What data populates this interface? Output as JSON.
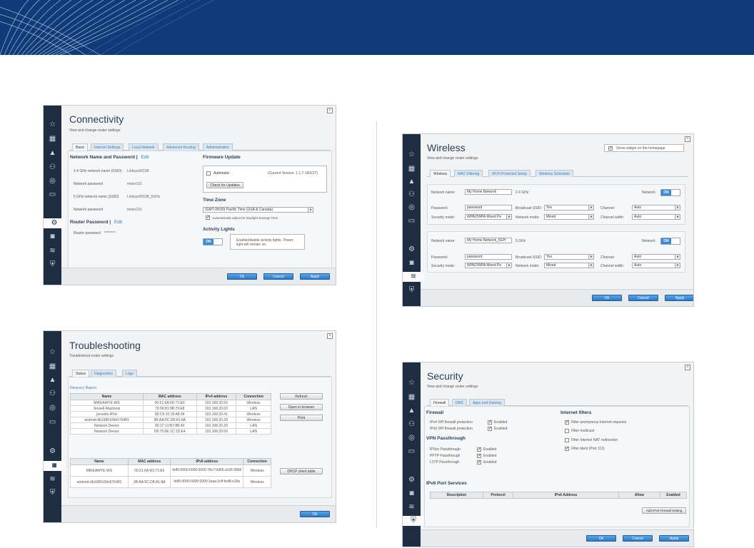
{
  "connectivity": {
    "title": "Connectivity",
    "subtitle": "View and change router settings",
    "tabs": [
      "Basic",
      "Internet Settings",
      "Local Network",
      "Advanced Routing",
      "Administration"
    ],
    "network_header": "Network Name and Password",
    "edit": "Edit",
    "rows": [
      {
        "label": "2.4 GHz network name (SSID)",
        "value": "Linksys00198"
      },
      {
        "label": "Network password",
        "value": "meier131"
      },
      {
        "label": "5 GHz network name (SSID)",
        "value": "Linksys00198_5GHz"
      },
      {
        "label": "Network password",
        "value": "meier131"
      }
    ],
    "router_password_header": "Router Password",
    "router_password_label": "Router password",
    "router_password_value": "********",
    "firmware_header": "Firmware Update",
    "automatic_label": "Automatic",
    "current_version": "(Current Version: 1.1.7.160227)",
    "check_updates": "Check for Updates",
    "timezone_header": "Time Zone",
    "timezone_value": "(GMT-08:00) Pacific Time (USA & Canada)",
    "dst_label": "Automatically adjust for Daylight Savings Time",
    "activity_header": "Activity Lights",
    "toggle_on": "ON",
    "activity_text": "Enable/disable activity lights. Power light will remain on.",
    "ok": "Ok",
    "cancel": "Cancel",
    "apply": "Apply"
  },
  "wireless": {
    "title": "Wireless",
    "subtitle": "View and change router settings",
    "show_widget": "Show widget on the homepage",
    "tabs": [
      "Wireless",
      "MAC Filtering",
      "Wi-Fi Protected Setup",
      "Wireless Scheduler"
    ],
    "band1": {
      "network_name_label": "Network name:",
      "network_name": "My Home Network",
      "band": "2.4 GHz",
      "network_label": "Network:",
      "toggle": "ON",
      "password_label": "Password:",
      "password": "password",
      "broadcast_label": "Broadcast SSID:",
      "broadcast": "Yes",
      "channel_label": "Channel:",
      "channel": "Auto",
      "security_label": "Security mode:",
      "security": "WPA2/WPA Mixed Pe",
      "mode_label": "Network mode:",
      "mode": "Mixed",
      "width_label": "Channel width:",
      "width": "Auto"
    },
    "band2": {
      "network_name_label": "Network name:",
      "network_name": "My Home Network_5GH",
      "band": "5 GHz",
      "network_label": "Network:",
      "toggle": "ON",
      "password_label": "Password:",
      "password": "password",
      "broadcast_label": "Broadcast SSID:",
      "broadcast": "Yes",
      "channel_label": "Channel:",
      "channel": "Auto",
      "security_label": "Security mode:",
      "security": "WPA2/WPA Mixed Pe",
      "mode_label": "Network mode:",
      "mode": "Mixed",
      "width_label": "Channel width:",
      "width": "Auto"
    },
    "ok": "Ok",
    "cancel": "Cancel",
    "apply": "Apply"
  },
  "troubleshooting": {
    "title": "Troubleshooting",
    "subtitle": "Troubleshoot router settings",
    "tabs": [
      "Status",
      "Diagnostics",
      "Logs"
    ],
    "devices_link": "Devices",
    "report_link": "Report",
    "ipv4_headers": [
      "Name",
      "MAC address",
      "IPv4 address",
      "Connection"
    ],
    "ipv4_rows": [
      [
        "MIKEAWYE-WS",
        "00:21:6A:6D:71:E6",
        "192.168.20.50",
        "Wireless"
      ],
      [
        "Jensell-Macbook",
        "70:56:81:9B:79:E8",
        "192.168.20.63",
        "LAN"
      ],
      [
        "jensells-iPod",
        "00:C6:10:19:A8:34",
        "192.168.20.41",
        "Wireless"
      ],
      [
        "android-db1686169e576481",
        "3B:AA:5C:D8:A1:8A",
        "192.168.20.39",
        "Wireless"
      ],
      [
        "Network Device",
        "00:27:13:B7:8B:40",
        "192.168.20.29",
        "LAN"
      ],
      [
        "Network Device",
        "D8:75:0E:1C:1D:E4",
        "192.168.20.59",
        "LAN"
      ]
    ],
    "ipv6_headers": [
      "Name",
      "MAC address",
      "IPv6 address",
      "Connection"
    ],
    "ipv6_rows": [
      [
        "MIKEAWYE-WS",
        "00:21:6A:6D:71:E6",
        "fe80:0000:0000:0000:78c7:9d95:cb39:3858",
        "Wireless"
      ],
      [
        "android-db1686169e576481",
        "3B:AA:5C:D8:A1:8A",
        "fe80:0000:0000:0000:3aaa:3cff:fed8:a18a",
        "Wireless"
      ]
    ],
    "refresh": "Refresh",
    "open_browser": "Open in browser",
    "print": "Print",
    "dhcp": "DHCP client table",
    "ok": "Ok"
  },
  "security": {
    "title": "Security",
    "subtitle": "View and change router settings",
    "tabs": [
      "Firewall",
      "DMZ",
      "Apps and Gaming"
    ],
    "firewall_header": "Firewall",
    "firewall_rows": [
      {
        "label": "IPv4 SPI firewall protection",
        "value": "Enabled"
      },
      {
        "label": "IPv6 SPI firewall protection",
        "value": "Enabled"
      }
    ],
    "vpn_header": "VPN Passthrough",
    "vpn_rows": [
      {
        "label": "IPSec Passthrough",
        "value": "Enabled"
      },
      {
        "label": "PPTP Passthrough",
        "value": "Enabled"
      },
      {
        "label": "L2TP Passthrough",
        "value": "Enabled"
      }
    ],
    "filters_header": "Internet filters",
    "filters": [
      {
        "label": "Filter anonymous Internet requests",
        "checked": true
      },
      {
        "label": "Filter multicast",
        "checked": false
      },
      {
        "label": "Filter Internet NAT redirection",
        "checked": false
      },
      {
        "label": "Filter ident (Port 113)",
        "checked": true
      }
    ],
    "ipv6_header": "IPv6 Port Services",
    "ipv6_cols": [
      "Description",
      "Protocol",
      "IPv6 Address",
      "Allow",
      "Enabled"
    ],
    "add_rule": "Add IPv6 Firewall Setting",
    "ok": "Ok",
    "cancel": "Cancel",
    "apply": "Apply"
  },
  "colors": {
    "banner": "#0f3c78",
    "sidebar": "#1e2d42",
    "accent": "#3a8ad6"
  },
  "sidebar_icons": [
    "widgets-icon",
    "devices-icon",
    "alert-icon",
    "parental-icon",
    "media-icon",
    "ports-icon",
    "connectivity-icon",
    "troubleshooting-icon",
    "wireless-icon",
    "security-icon"
  ]
}
